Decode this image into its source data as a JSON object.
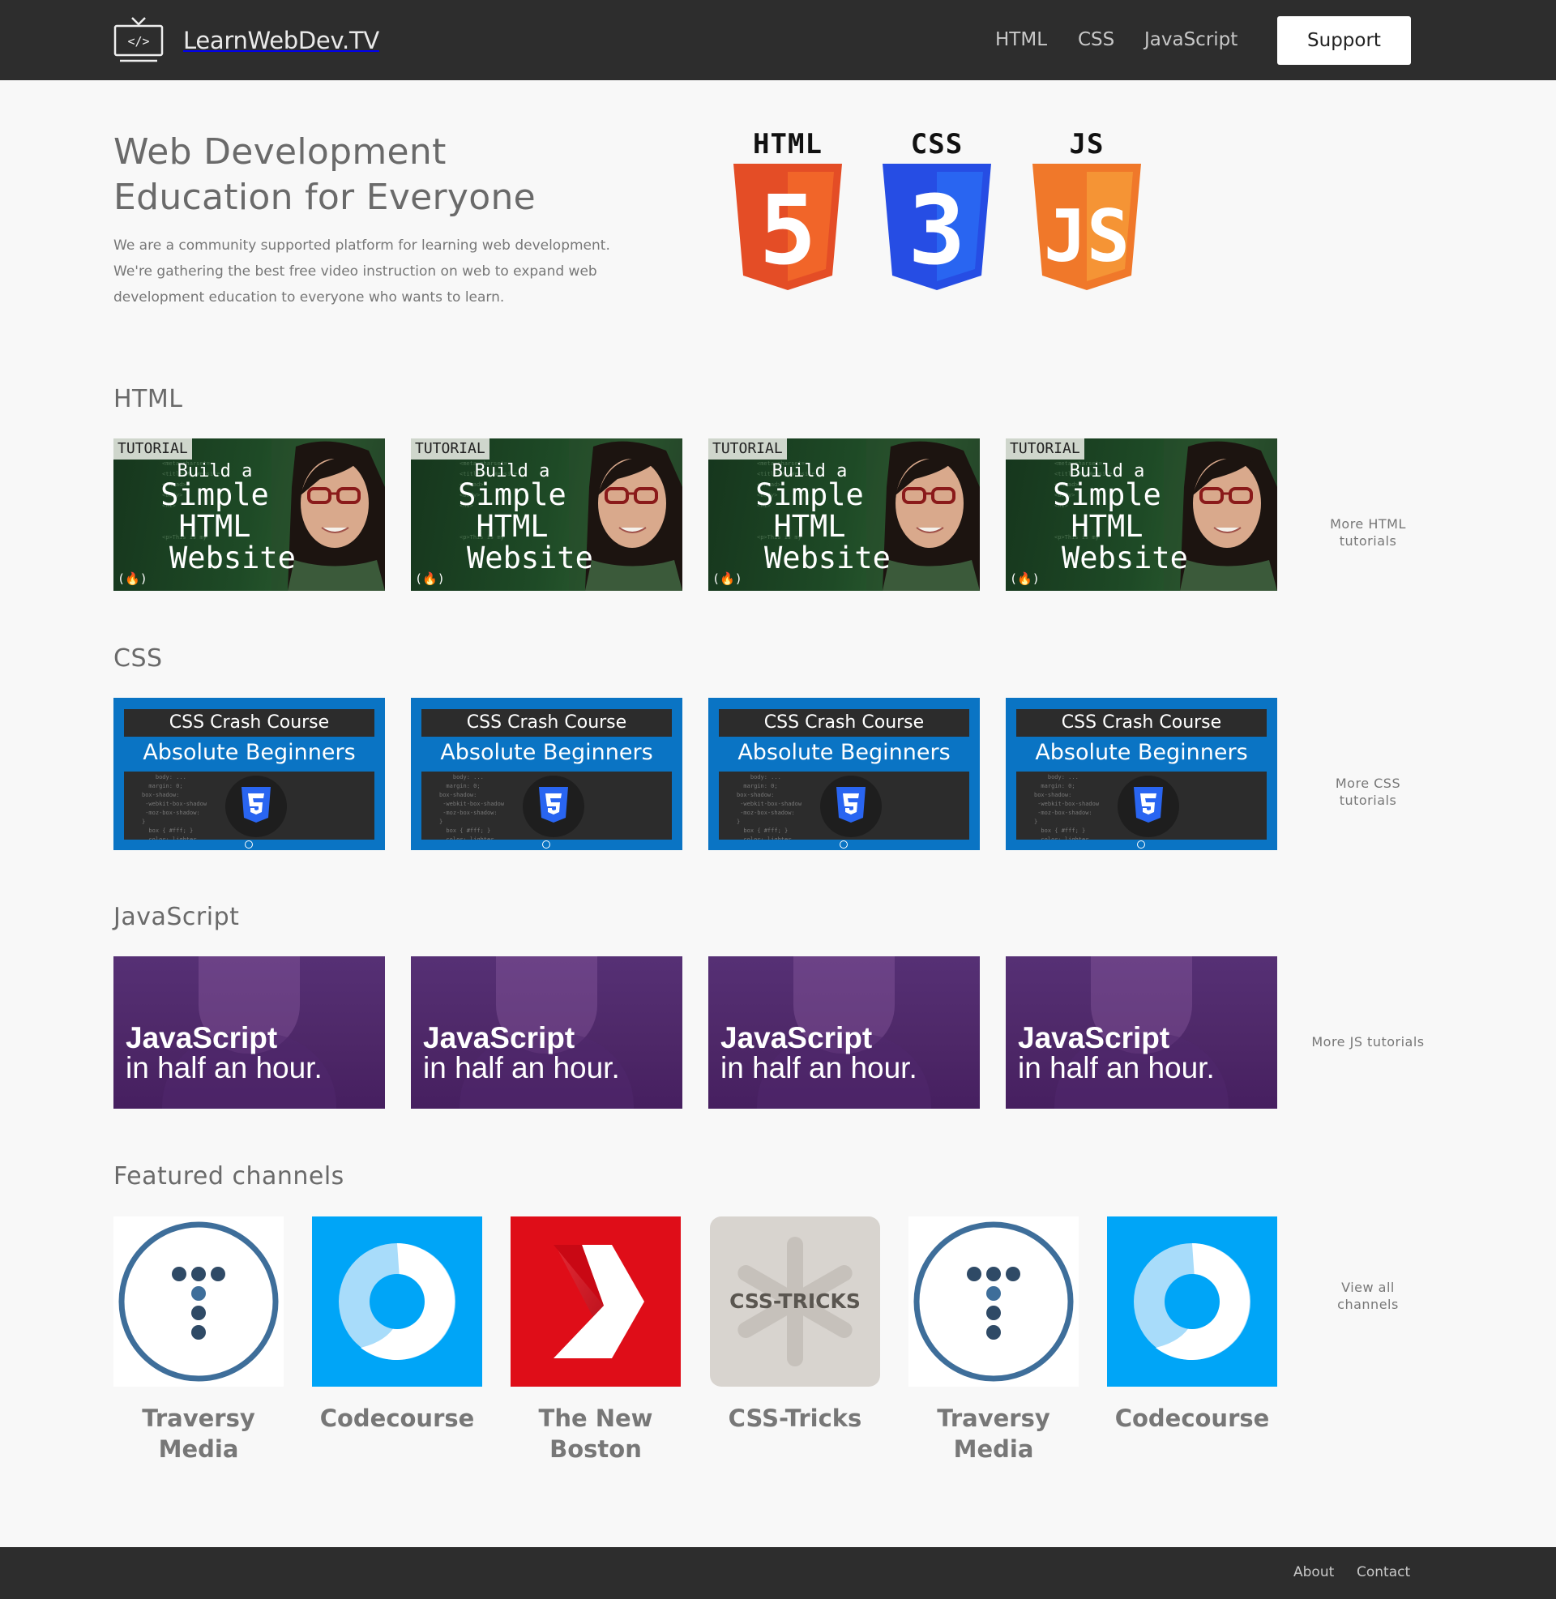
{
  "header": {
    "brand": "LearnWebDev.TV",
    "nav": [
      {
        "label": "HTML"
      },
      {
        "label": "CSS"
      },
      {
        "label": "JavaScript"
      }
    ],
    "support_label": "Support"
  },
  "hero": {
    "title": "Web Development Education for Everyone",
    "description": "We are a community supported platform for learning web development. We're gathering the best free video instruction on web to expand web development education to everyone who wants to learn.",
    "logos": [
      "HTML",
      "CSS",
      "JS"
    ],
    "logo_numbers": [
      "5",
      "3"
    ]
  },
  "sections": {
    "html": {
      "title": "HTML",
      "more": "More HTML tutorials",
      "thumb": {
        "tag": "TUTORIAL",
        "line1": "Build a",
        "line2": "Simple",
        "line3": "HTML",
        "line4": "Website"
      }
    },
    "css": {
      "title": "CSS",
      "more": "More CSS tutorials",
      "thumb": {
        "bar": "CSS Crash Course",
        "sub": "Absolute Beginners"
      }
    },
    "js": {
      "title": "JavaScript",
      "more": "More JS tutorials",
      "thumb": {
        "line1": "JavaScript",
        "line2": "in half an hour."
      }
    }
  },
  "channels": {
    "title": "Featured channels",
    "more": "View all channels",
    "items": [
      {
        "name": "Traversy Media",
        "logo": "traversy"
      },
      {
        "name": "Codecourse",
        "logo": "codecourse"
      },
      {
        "name": "The New Boston",
        "logo": "newboston"
      },
      {
        "name": "CSS-Tricks",
        "logo": "csstricks",
        "logo_text": "CSS-TRICKS"
      },
      {
        "name": "Traversy Media",
        "logo": "traversy"
      },
      {
        "name": "Codecourse",
        "logo": "codecourse"
      }
    ]
  },
  "footer": {
    "about": "About",
    "contact": "Contact"
  },
  "colors": {
    "bar": "#2d2d2d",
    "page_bg": "#f8f8f8",
    "html_orange": "#e44d26",
    "css_blue": "#264de4",
    "js_orange": "#f0782a",
    "css_thumb_blue": "#0a74c4",
    "js_purple": "#4e2868",
    "codecourse_blue": "#00a5f7",
    "newboston_red": "#df0d18"
  }
}
